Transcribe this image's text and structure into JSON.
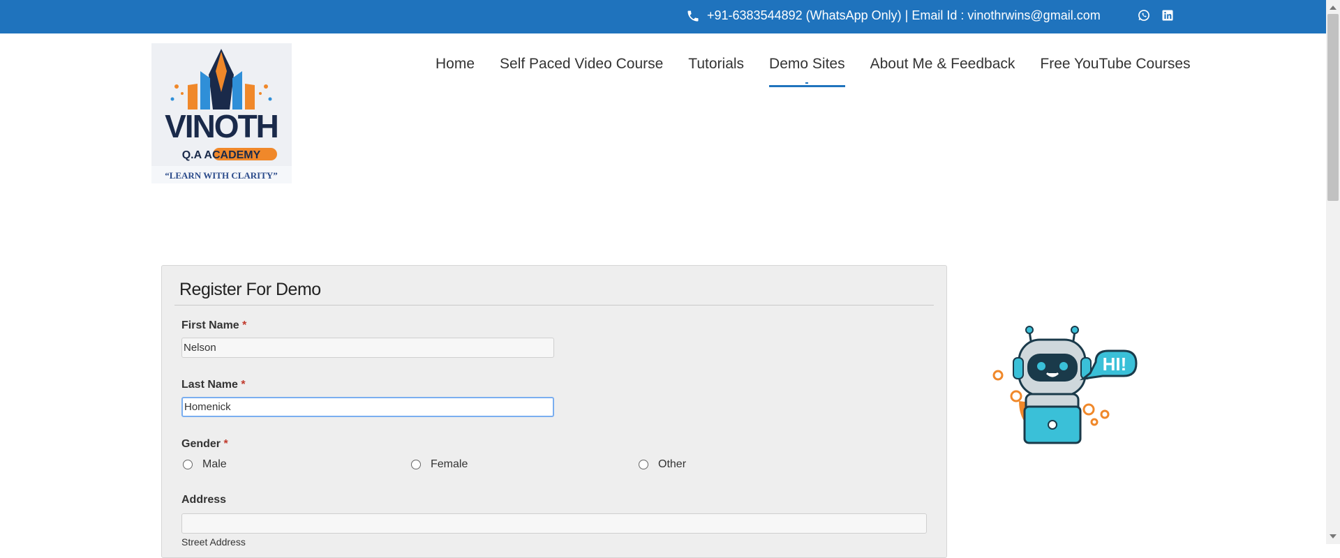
{
  "topbar": {
    "contact": "+91-6383544892 (WhatsApp Only) | Email Id : vinothrwins@gmail.com",
    "icons": [
      "phone-icon",
      "whatsapp-icon",
      "linkedin-icon"
    ]
  },
  "logo": {
    "brand": "VINOTH",
    "sub": "Q.A ACADEMY",
    "tagline": "“LEARN WITH CLARITY”"
  },
  "nav": {
    "items": [
      "Home",
      "Self Paced Video Course",
      "Tutorials",
      "Demo Sites",
      "About Me & Feedback",
      "Free YouTube Courses"
    ],
    "active": "Demo Sites"
  },
  "form": {
    "title": "Register For Demo",
    "first_name": {
      "label": "First Name",
      "required": "*",
      "value": "Nelson"
    },
    "last_name": {
      "label": "Last Name",
      "required": "*",
      "value": "Homenick"
    },
    "gender": {
      "label": "Gender",
      "required": "*",
      "options": [
        "Male",
        "Female",
        "Other"
      ]
    },
    "address": {
      "label": "Address",
      "value": "",
      "street_label": "Street Address"
    }
  },
  "bot": {
    "bubble_text": "HI!"
  },
  "colors": {
    "topbar": "#1f73bd",
    "required": "#c0392b",
    "focus": "#7aaef0",
    "panel": "#eeeeee"
  }
}
